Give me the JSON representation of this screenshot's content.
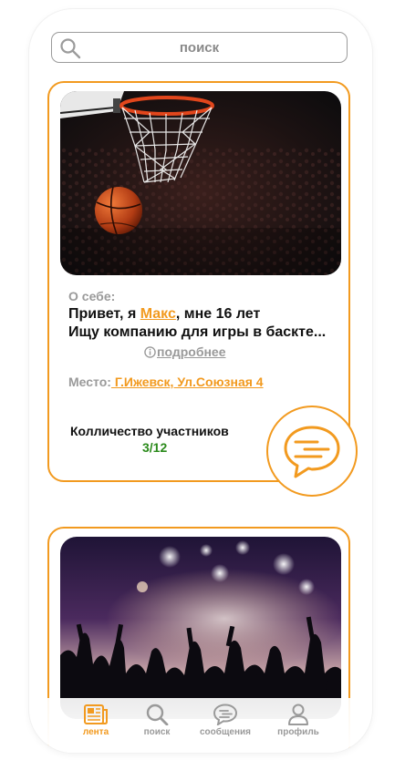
{
  "search": {
    "placeholder": "поиск"
  },
  "colors": {
    "accent": "#f29a1f",
    "count": "#2a8a1a",
    "muted": "#9a9a9a"
  },
  "posts": [
    {
      "image": "basketball-hoop-photo",
      "about_label": "О себе:",
      "greeting_prefix": "Привет, я",
      "name": "Макс",
      "greeting_suffix": ", мне 16 лет",
      "description": "Ищу компанию для игры в баскте...",
      "more_label": "подробнее",
      "place_label": "Место:",
      "place_value": " Г.Ижевск, Ул.Союзная 4",
      "participants_label": "Колличество участников",
      "participants_value": "3/12"
    },
    {
      "image": "concert-crowd-photo"
    }
  ],
  "tabbar": [
    {
      "label": "лента",
      "icon": "newspaper-icon",
      "active": true
    },
    {
      "label": "поиск",
      "icon": "search-icon",
      "active": false
    },
    {
      "label": "сообщения",
      "icon": "chat-icon",
      "active": false
    },
    {
      "label": "профиль",
      "icon": "user-icon",
      "active": false
    }
  ]
}
